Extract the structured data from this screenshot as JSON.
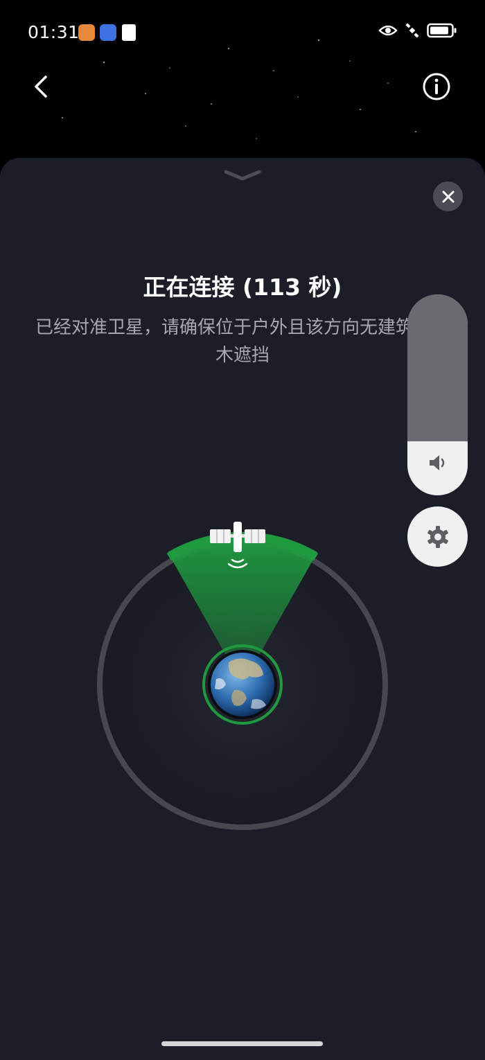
{
  "status_bar": {
    "time": "01:31",
    "notification_icons": [
      "shield-app-icon",
      "chat-app-icon",
      "alert-app-icon"
    ],
    "right_icons": [
      "eye-icon",
      "satellite-icon",
      "battery-icon"
    ]
  },
  "nav": {
    "back_icon": "chevron-left-icon",
    "info_icon": "info-icon"
  },
  "sheet": {
    "title": "正在连接 (113 秒)",
    "subtitle": "已经对准卫星，请确保位于户外且该方向无建筑或树木遮挡",
    "close_icon": "close-icon",
    "volume": {
      "level": 0.27,
      "icon": "speaker-icon"
    },
    "settings_icon": "gear-icon"
  },
  "colors": {
    "sheet_bg": "#1b1e29",
    "accent_green": "#1f9a3f",
    "button_bg": "#f0f0f0"
  }
}
